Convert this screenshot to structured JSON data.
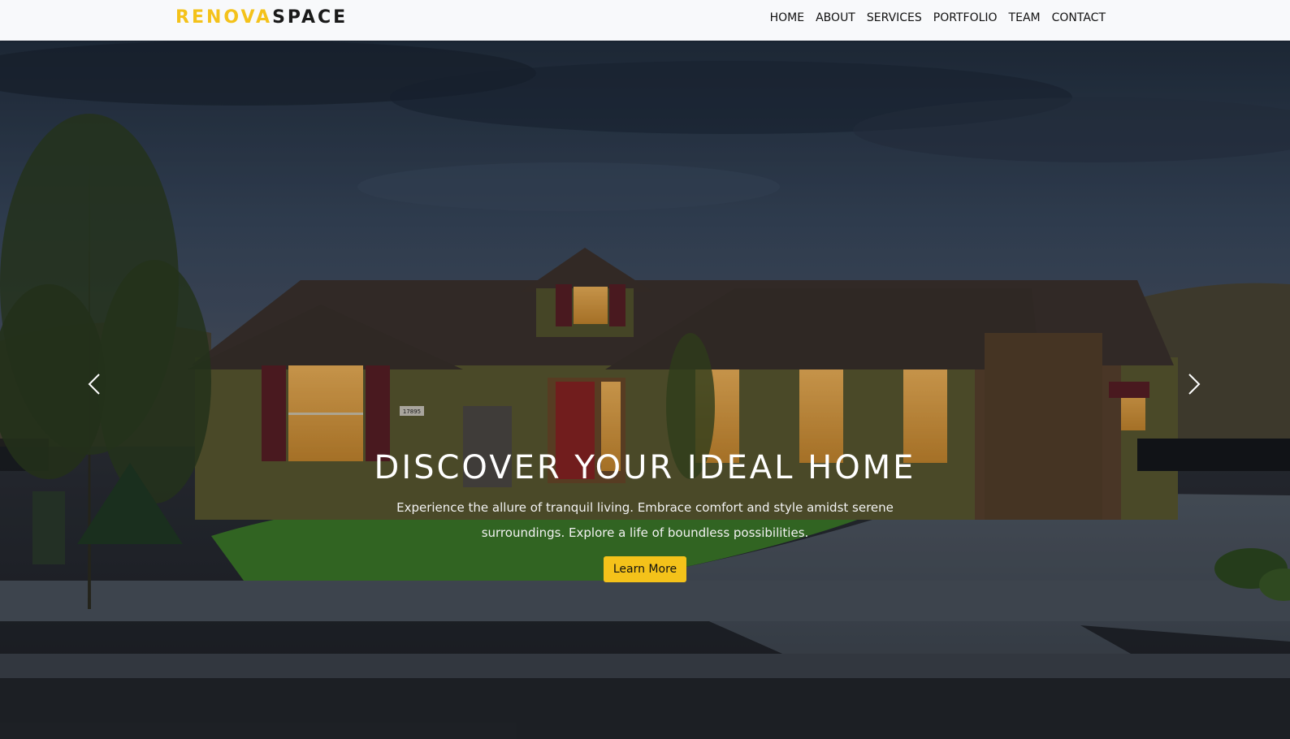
{
  "brand": {
    "part1": "RENOVA",
    "part2": "SPACE"
  },
  "nav": {
    "home": "HOME",
    "about": "ABOUT",
    "services": "SERVICES",
    "portfolio": "PORTFOLIO",
    "team": "TEAM",
    "contact": "CONTACT"
  },
  "hero": {
    "title": "DISCOVER YOUR IDEAL HOME",
    "subtitle": "Experience the allure of tranquil living. Embrace comfort and style amidst serene surroundings. Explore a life of boundless possibilities.",
    "button": "Learn More",
    "house_number": "17895"
  },
  "carousel": {
    "prev_icon": "chevron-left-icon",
    "next_icon": "chevron-right-icon"
  },
  "colors": {
    "accent": "#f4c21a",
    "navbar_bg": "#f8f9fb",
    "text_dark": "#111111"
  }
}
